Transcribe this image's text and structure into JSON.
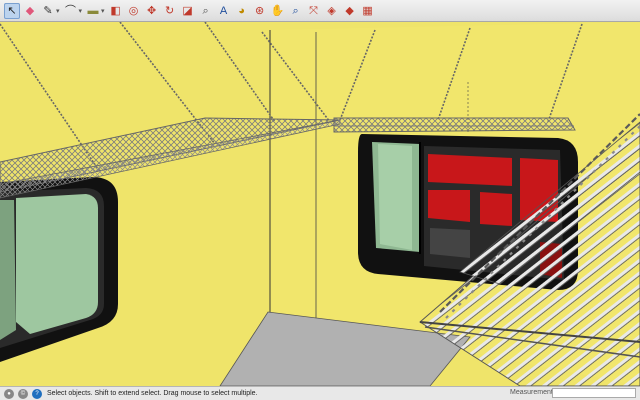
{
  "toolbar": {
    "tools": [
      {
        "name": "select-tool-icon",
        "glyph": "↖",
        "color": "#222222",
        "selected": true
      },
      {
        "name": "eraser-tool-icon",
        "glyph": "◆",
        "color": "#e0577a"
      },
      {
        "name": "line-tool-icon",
        "glyph": "✎",
        "color": "#333333",
        "dropdown": true
      },
      {
        "name": "arc-tool-icon",
        "glyph": "⌒",
        "color": "#333333",
        "dropdown": true
      },
      {
        "name": "rectangle-tool-icon",
        "glyph": "▬",
        "color": "#8a8a3a",
        "dropdown": true
      },
      {
        "name": "push-pull-tool-icon",
        "glyph": "◧",
        "color": "#c0392b"
      },
      {
        "name": "offset-tool-icon",
        "glyph": "◎",
        "color": "#c0392b"
      },
      {
        "name": "move-tool-icon",
        "glyph": "✥",
        "color": "#c0392b"
      },
      {
        "name": "rotate-tool-icon",
        "glyph": "↻",
        "color": "#c0392b"
      },
      {
        "name": "scale-tool-icon",
        "glyph": "◪",
        "color": "#c0392b"
      },
      {
        "name": "tape-measure-tool-icon",
        "glyph": "⌕",
        "color": "#555555"
      },
      {
        "name": "text-tool-icon",
        "glyph": "A",
        "color": "#1f4e9c"
      },
      {
        "name": "paint-bucket-tool-icon",
        "glyph": "◕",
        "color": "#c08a00"
      },
      {
        "name": "orbit-tool-icon",
        "glyph": "⊛",
        "color": "#c0392b"
      },
      {
        "name": "pan-tool-icon",
        "glyph": "✋",
        "color": "#1f6fbf"
      },
      {
        "name": "zoom-tool-icon",
        "glyph": "⌕",
        "color": "#1f4e9c"
      },
      {
        "name": "zoom-extents-tool-icon",
        "glyph": "⤧",
        "color": "#c0392b"
      },
      {
        "name": "3d-warehouse-icon",
        "glyph": "◈",
        "color": "#c0392b"
      },
      {
        "name": "extension-warehouse-icon",
        "glyph": "◆",
        "color": "#c0392b"
      },
      {
        "name": "layout-icon",
        "glyph": "▦",
        "color": "#c0392b"
      }
    ]
  },
  "status": {
    "message": "Select objects. Shift to extend select. Drag mouse to select multiple.",
    "measurements_label": "Measurements",
    "measurements_value": ""
  },
  "colors": {
    "wall": "#efe46a",
    "wall_shade": "#e3d85c",
    "floor": "#b3b3b3",
    "window_frame": "#111111",
    "window_glass": "#9ec7a0",
    "window_red": "#c8171a",
    "rack_metal": "#8f8f8f"
  }
}
